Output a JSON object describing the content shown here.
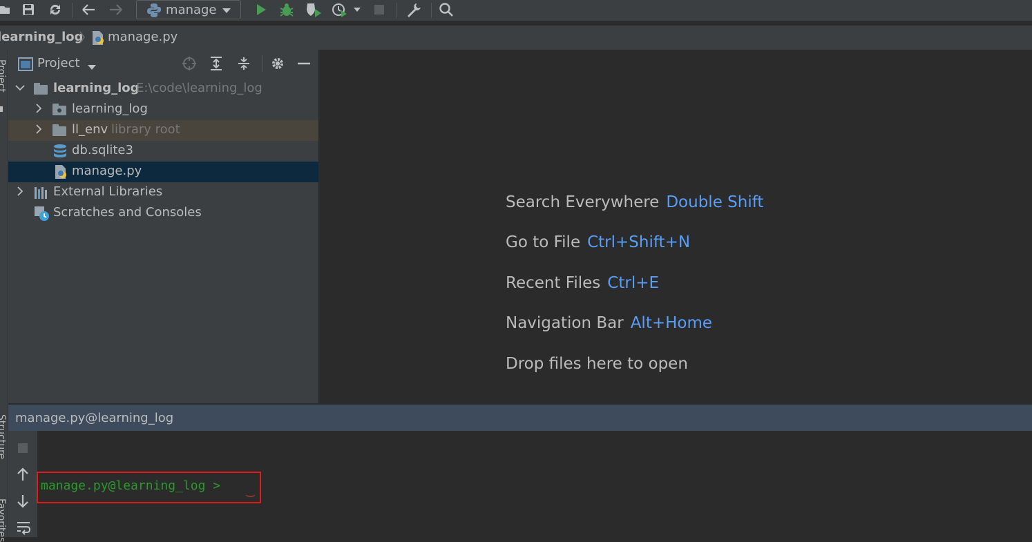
{
  "toolbar": {
    "run_config": "manage",
    "icons": [
      "folder-icon",
      "save-icon",
      "sync-icon",
      "back-icon",
      "forward-icon",
      "python-icon",
      "run-icon",
      "debug-icon",
      "coverage-icon",
      "profile-icon",
      "stop-icon",
      "wrench-icon",
      "search-icon"
    ]
  },
  "breadcrumb": {
    "project": "learning_log",
    "file": "manage.py"
  },
  "left_strip": {
    "project_label": "Project",
    "structure_label": "Structure",
    "favorites_label": "Favorites"
  },
  "project_panel": {
    "title": "Project",
    "tree": [
      {
        "label": "learning_log",
        "hint": "E:\\code\\learning_log"
      },
      {
        "label": "learning_log"
      },
      {
        "label": "ll_env",
        "hint": "library root"
      },
      {
        "label": "db.sqlite3"
      },
      {
        "label": "manage.py"
      },
      {
        "label": "External Libraries"
      },
      {
        "label": "Scratches and Consoles"
      }
    ]
  },
  "editor": {
    "hints": [
      {
        "text": "Search Everywhere",
        "key": "Double Shift"
      },
      {
        "text": "Go to File",
        "key": "Ctrl+Shift+N"
      },
      {
        "text": "Recent Files",
        "key": "Ctrl+E"
      },
      {
        "text": "Navigation Bar",
        "key": "Alt+Home"
      },
      {
        "text": "Drop files here to open",
        "key": ""
      }
    ]
  },
  "console": {
    "title": "manage.py@learning_log",
    "prompt": "manage.py@learning_log >"
  },
  "colors": {
    "accent_key": "#589df6",
    "prompt_green": "#2b9a2b",
    "highlight_red": "#e01b1b",
    "selected_row": "#0d293e",
    "library_row": "#49453c"
  }
}
